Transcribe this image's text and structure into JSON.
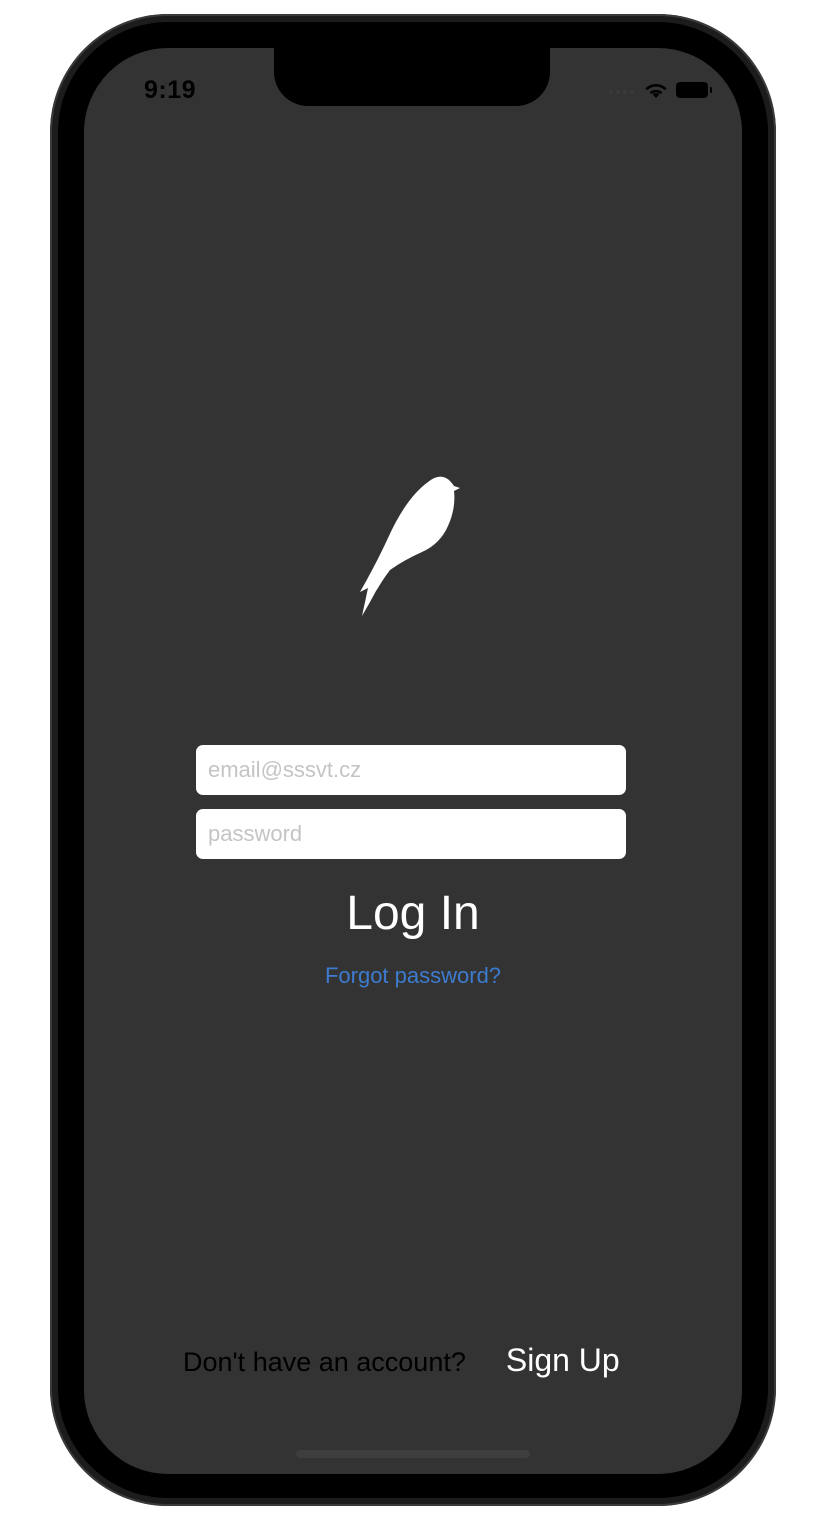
{
  "status_bar": {
    "time": "9:19",
    "signal_icon": "signal-dots-icon",
    "wifi_icon": "wifi-icon",
    "battery_icon": "battery-icon"
  },
  "app": {
    "logo_icon": "bird-icon",
    "background_color": "#333333",
    "link_color": "#3d7bcf"
  },
  "login_form": {
    "email_placeholder": "email@sssvt.cz",
    "email_value": "",
    "password_placeholder": "password",
    "password_value": "",
    "login_label": "Log In",
    "forgot_password_label": "Forgot password?"
  },
  "signup": {
    "prompt": "Don't have an account?",
    "button_label": "Sign Up"
  }
}
